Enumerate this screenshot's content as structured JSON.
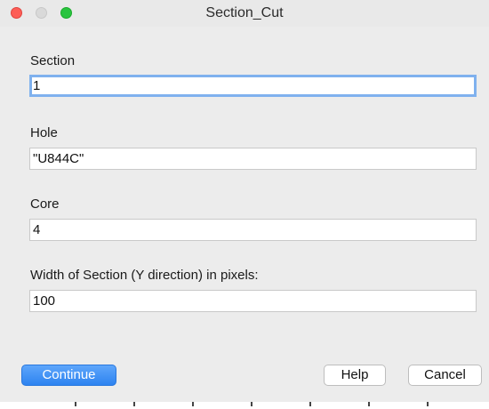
{
  "window": {
    "title": "Section_Cut"
  },
  "form": {
    "section": {
      "label": "Section",
      "value": "1"
    },
    "hole": {
      "label": "Hole",
      "value": "\"U844C\""
    },
    "core": {
      "label": "Core",
      "value": "4"
    },
    "width": {
      "label": "Width of Section (Y direction) in pixels:",
      "value": "100"
    }
  },
  "buttons": {
    "continue_label": "Continue",
    "help_label": "Help",
    "cancel_label": "Cancel"
  },
  "colors": {
    "window_bg": "#ececec",
    "primary_button": "#2d83f0",
    "focus_ring": "#7fb1ee",
    "close_light": "#fd5e57",
    "zoom_light": "#29c43f"
  }
}
